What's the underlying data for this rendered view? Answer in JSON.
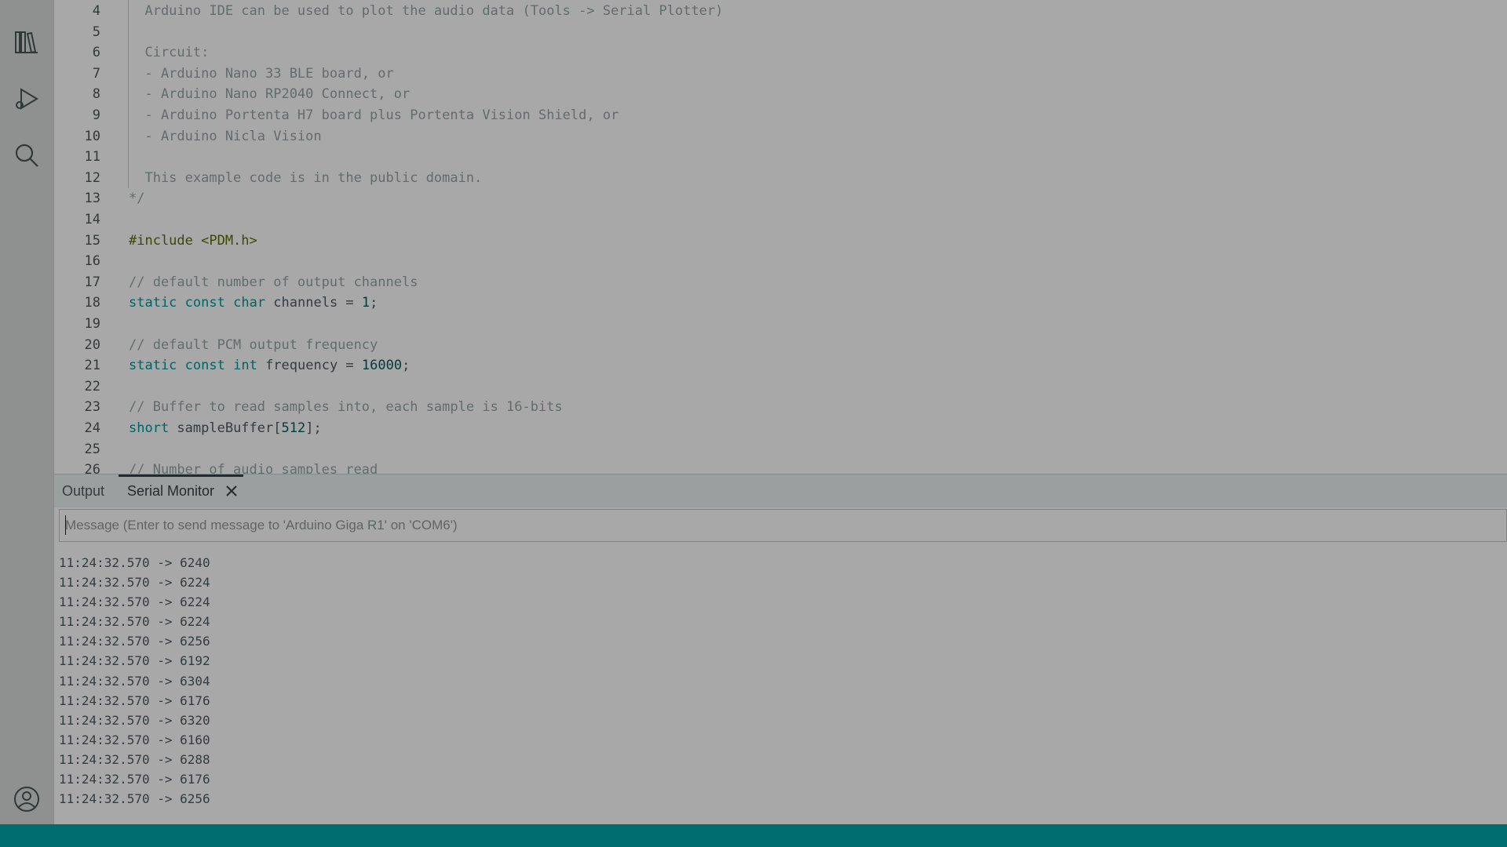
{
  "activity_bar": {
    "icons": [
      "library-icon",
      "debug-icon",
      "search-icon",
      "account-icon"
    ]
  },
  "editor": {
    "lines": [
      {
        "n": "4",
        "text": "  Arduino IDE can be used to plot the audio data (Tools -> Serial Plotter)",
        "kind": "comment"
      },
      {
        "n": "5",
        "text": "",
        "kind": "comment"
      },
      {
        "n": "6",
        "text": "  Circuit:",
        "kind": "comment"
      },
      {
        "n": "7",
        "text": "  - Arduino Nano 33 BLE board, or",
        "kind": "comment"
      },
      {
        "n": "8",
        "text": "  - Arduino Nano RP2040 Connect, or",
        "kind": "comment"
      },
      {
        "n": "9",
        "text": "  - Arduino Portenta H7 board plus Portenta Vision Shield, or",
        "kind": "comment"
      },
      {
        "n": "10",
        "text": "  - Arduino Nicla Vision",
        "kind": "comment"
      },
      {
        "n": "11",
        "text": "",
        "kind": "comment"
      },
      {
        "n": "12",
        "text": "  This example code is in the public domain.",
        "kind": "comment"
      },
      {
        "n": "13",
        "text": "*/",
        "kind": "comment"
      },
      {
        "n": "14",
        "text": "",
        "kind": "code"
      },
      {
        "n": "15",
        "text": "#include <PDM.h>",
        "kind": "pp"
      },
      {
        "n": "16",
        "text": "",
        "kind": "code"
      },
      {
        "n": "17",
        "text": "// default number of output channels",
        "kind": "comment"
      },
      {
        "n": "18",
        "text": "",
        "kind": "code",
        "tokens": [
          [
            "static",
            "kw"
          ],
          [
            " ",
            ""
          ],
          [
            "const",
            "kw"
          ],
          [
            " ",
            ""
          ],
          [
            "char",
            "ty"
          ],
          [
            " channels = ",
            ""
          ],
          [
            "1",
            "num"
          ],
          [
            ";",
            ""
          ]
        ]
      },
      {
        "n": "19",
        "text": "",
        "kind": "code"
      },
      {
        "n": "20",
        "text": "// default PCM output frequency",
        "kind": "comment"
      },
      {
        "n": "21",
        "text": "",
        "kind": "code",
        "tokens": [
          [
            "static",
            "kw"
          ],
          [
            " ",
            ""
          ],
          [
            "const",
            "kw"
          ],
          [
            " ",
            ""
          ],
          [
            "int",
            "ty"
          ],
          [
            " frequency = ",
            ""
          ],
          [
            "16000",
            "num"
          ],
          [
            ";",
            ""
          ]
        ]
      },
      {
        "n": "22",
        "text": "",
        "kind": "code"
      },
      {
        "n": "23",
        "text": "// Buffer to read samples into, each sample is 16-bits",
        "kind": "comment"
      },
      {
        "n": "24",
        "text": "",
        "kind": "code",
        "tokens": [
          [
            "short",
            "ty"
          ],
          [
            " sampleBuffer[",
            ""
          ],
          [
            "512",
            "num"
          ],
          [
            "];",
            ""
          ]
        ]
      },
      {
        "n": "25",
        "text": "",
        "kind": "code"
      },
      {
        "n": "26",
        "text": "// Number of audio samples read",
        "kind": "comment"
      }
    ]
  },
  "panel": {
    "tabs": [
      {
        "label": "Output"
      },
      {
        "label": "Serial Monitor"
      }
    ],
    "message_placeholder": "Message (Enter to send message to 'Arduino Giga R1' on 'COM6')",
    "serial_lines": [
      "11:24:32.570 -> 6240",
      "11:24:32.570 -> 6224",
      "11:24:32.570 -> 6224",
      "11:24:32.570 -> 6224",
      "11:24:32.570 -> 6256",
      "11:24:32.570 -> 6192",
      "11:24:32.570 -> 6304",
      "11:24:32.570 -> 6176",
      "11:24:32.570 -> 6320",
      "11:24:32.570 -> 6160",
      "11:24:32.570 -> 6288",
      "11:24:32.570 -> 6176",
      "11:24:32.570 -> 6256"
    ]
  },
  "colors": {
    "accent": "#00979c",
    "status_bar": "#006d70"
  }
}
